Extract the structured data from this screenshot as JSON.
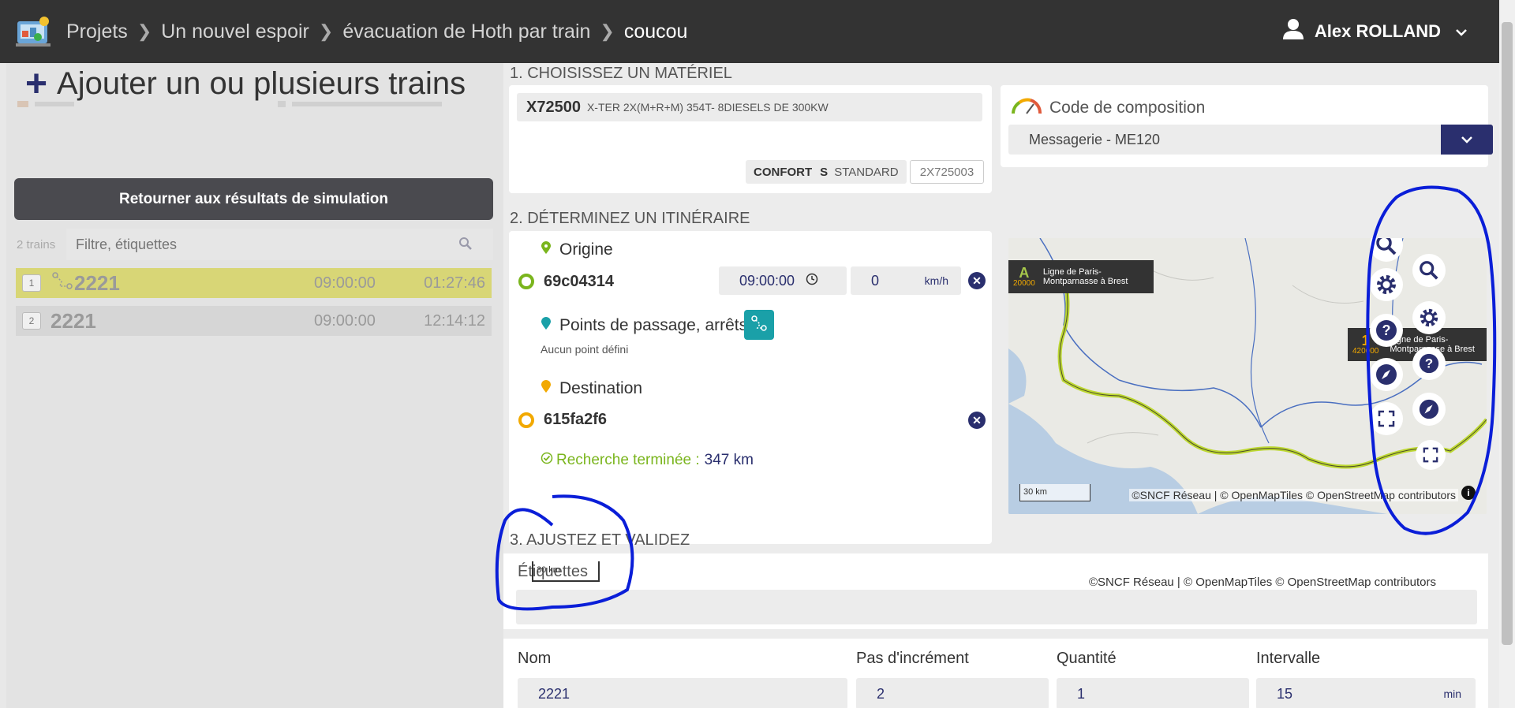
{
  "header": {
    "breadcrumb": [
      "Projets",
      "Un nouvel espoir",
      "évacuation de Hoth par train",
      "coucou"
    ],
    "user_name": "Alex ROLLAND"
  },
  "left": {
    "title": "Ajouter un ou plusieurs trains",
    "back_button": "Retourner aux résultats de simulation",
    "train_count": "2 trains",
    "filter_placeholder": "Filtre, étiquettes",
    "trains": [
      {
        "index": "1",
        "name": "2221",
        "start": "09:00:00",
        "end": "01:27:46"
      },
      {
        "index": "2",
        "name": "2221",
        "start": "09:00:00",
        "end": "12:14:12"
      }
    ]
  },
  "material": {
    "section_title": "1. CHOISISSEZ UN MATÉRIEL",
    "code": "X72500",
    "description": "X-TER 2X(M+R+M) 354T- 8DIESELS DE 300KW",
    "confort_label": "CONFORT",
    "confort_s": "S",
    "confort_value": "STANDARD",
    "material_code": "2X725003"
  },
  "composition": {
    "title": "Code de composition",
    "selected": "Messagerie - ME120"
  },
  "itinerary": {
    "section_title": "2. DÉTERMINEZ UN ITINÉRAIRE",
    "origin_label": "Origine",
    "origin_value": "69c04314",
    "time": "09:00:00",
    "speed": "0",
    "speed_unit": "km/h",
    "waypoints_label": "Points de passage, arrêts",
    "waypoints_note": "Aucun point défini",
    "destination_label": "Destination",
    "destination_value": "615fa2f6",
    "status_label": "Recherche terminée :",
    "distance": "347 km"
  },
  "map": {
    "tooltip_marker": "A",
    "tooltip_pk": "20000",
    "tooltip_line1": "Ligne de Paris-",
    "tooltip_line2": "Montparnasse à Brest",
    "tooltip2_marker": "1",
    "tooltip2_pk": "420000",
    "tooltip2_line1": "Ligne de Paris-",
    "tooltip2_line2": "Montparnasse à Brest",
    "scale": "30 km",
    "attribution": "©SNCF Réseau | © OpenMapTiles © OpenStreetMap contributors"
  },
  "adjust": {
    "section_title": "3. AJUSTEZ ET VALIDEZ",
    "tags_label": "Étiquettes",
    "scale": "30 km",
    "attribution": "©SNCF Réseau | © OpenMapTiles © OpenStreetMap contributors",
    "fields": [
      {
        "label": "Nom",
        "value": "2221",
        "unit": ""
      },
      {
        "label": "Pas d'incrément",
        "value": "2",
        "unit": ""
      },
      {
        "label": "Quantité",
        "value": "1",
        "unit": ""
      },
      {
        "label": "Intervalle",
        "value": "15",
        "unit": "min"
      }
    ]
  },
  "colors": {
    "topbar": "#333333",
    "accent": "#2a2f6e",
    "selected_train": "#d8d676",
    "origin_green": "#7ab51d",
    "destination_yellow": "#f2a900",
    "waypoint_teal": "#1aa0a8",
    "annotation_blue": "#0a1ed8"
  }
}
